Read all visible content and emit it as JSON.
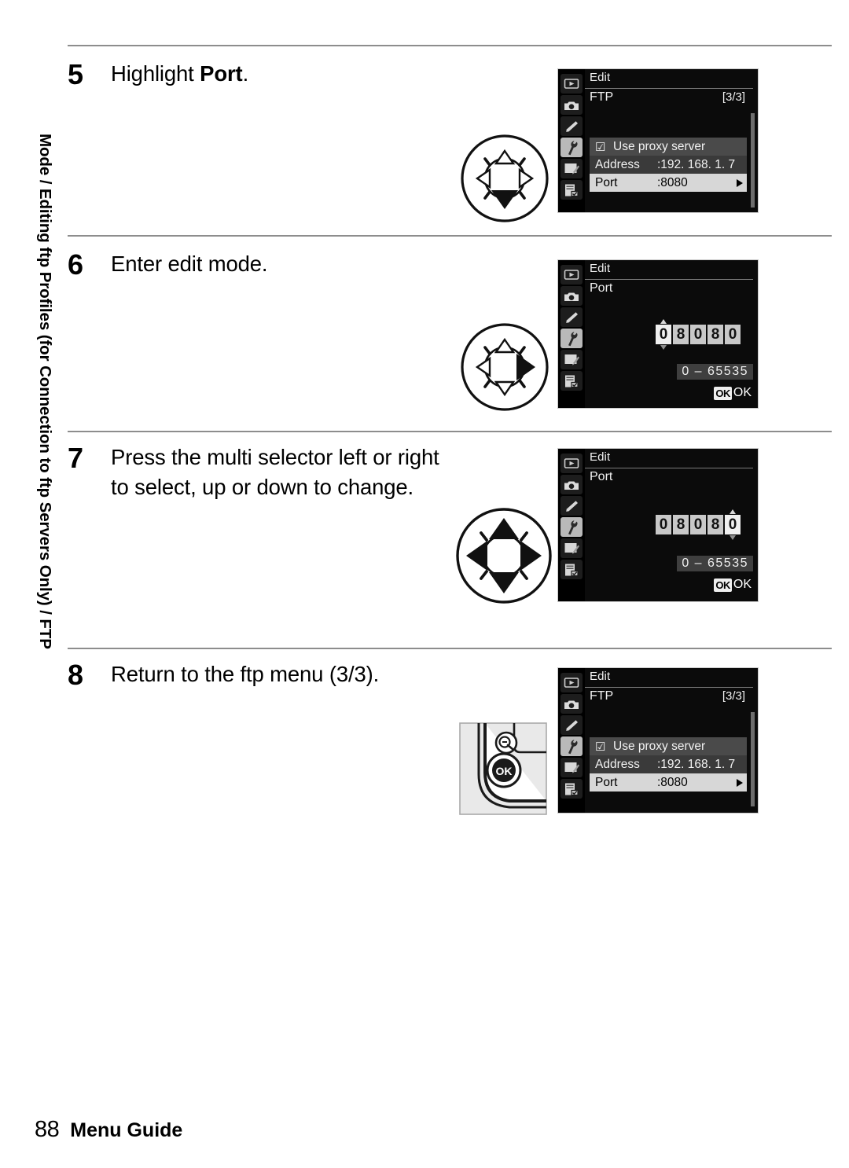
{
  "sidebar": {
    "running_head": "Mode / Editing ftp Profiles (for Connection to ftp Servers Only) / FTP"
  },
  "footer": {
    "page_number": "88",
    "label": "Menu Guide"
  },
  "steps": [
    {
      "number": "5",
      "text_prefix": "Highlight ",
      "text_bold": "Port",
      "text_suffix": ".",
      "control": "multi-selector-down"
    },
    {
      "number": "6",
      "text_prefix": "Enter edit mode.",
      "text_bold": "",
      "text_suffix": "",
      "control": "multi-selector-right"
    },
    {
      "number": "7",
      "text_prefix": "Press the multi selector left or right to select, up or down to change.",
      "text_bold": "",
      "text_suffix": "",
      "control": "multi-selector-all"
    },
    {
      "number": "8",
      "text_prefix": "Return to the ftp menu (3/3).",
      "text_bold": "",
      "text_suffix": "",
      "control": "ok-button"
    }
  ],
  "lcd_icons": [
    {
      "name": "playback-icon"
    },
    {
      "name": "shooting-menu-icon"
    },
    {
      "name": "custom-settings-icon"
    },
    {
      "name": "setup-menu-icon"
    },
    {
      "name": "retouch-menu-icon"
    },
    {
      "name": "my-menu-icon"
    }
  ],
  "screens": {
    "ftp_list_1": {
      "title": "Edit",
      "subtitle": "FTP",
      "page_indicator": "[3/3]",
      "checkbox_glyph": "☑",
      "proxy_label": "Use proxy server",
      "address_label": "Address",
      "address_value": ":192. 168. 1. 7",
      "port_label": "Port",
      "port_value": ":8080"
    },
    "port_edit_1": {
      "title": "Edit",
      "subtitle": "Port",
      "digits": [
        "0",
        "8",
        "0",
        "8",
        "0"
      ],
      "active_index": 0,
      "range": "0 – 65535",
      "ok_button": "OK",
      "ok_label": "OK"
    },
    "port_edit_2": {
      "title": "Edit",
      "subtitle": "Port",
      "digits": [
        "0",
        "8",
        "0",
        "8",
        "0"
      ],
      "active_index": 4,
      "range": "0 – 65535",
      "ok_button": "OK",
      "ok_label": "OK"
    },
    "ftp_list_2": {
      "title": "Edit",
      "subtitle": "FTP",
      "page_indicator": "[3/3]",
      "checkbox_glyph": "☑",
      "proxy_label": "Use proxy server",
      "address_label": "Address",
      "address_value": ":192. 168. 1. 7",
      "port_label": "Port",
      "port_value": ":8080"
    }
  },
  "ok_figure": {
    "zoom_icon_label": "zoom-out-help-icon",
    "ok_button_label": "OK"
  },
  "colors": {
    "rule": "#8d8d8d",
    "lcd_background": "#0b0b0b",
    "lcd_selected_row": "#d7d7d7",
    "lcd_shaded_row": "#3a3a3a"
  }
}
